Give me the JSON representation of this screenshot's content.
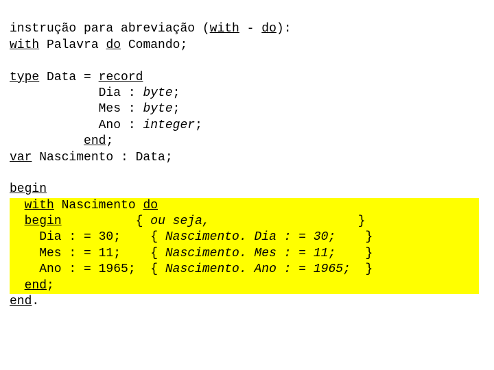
{
  "header": {
    "line1_a": "instrução para abreviação (",
    "line1_with": "with",
    "line1_mid": " - ",
    "line1_do": "do",
    "line1_end": "):",
    "line2_with": "with",
    "line2_mid": " Palavra ",
    "line2_do": "do",
    "line2_end": " Comando;"
  },
  "typedef": {
    "type_kw": "type",
    "type_rest": " Data = ",
    "record_kw": "record",
    "dia_label": "            Dia : ",
    "dia_type": "byte",
    "mes_label": "            Mes : ",
    "mes_type": "byte",
    "ano_label": "            Ano : ",
    "ano_type": "integer",
    "end_pad": "          ",
    "end_kw": "end",
    "end_semi": ";",
    "var_kw": "var",
    "var_rest": " Nascimento : Data;"
  },
  "body": {
    "begin_kw": "begin",
    "with_pad": "  ",
    "with_kw": "with",
    "with_mid": " Nascimento ",
    "do_kw": "do",
    "inner_begin_pad": "  ",
    "inner_begin_kw": "begin",
    "inner_begin_rest": "          ",
    "c1_open": "{ ",
    "c1_text": "ou seja,                   ",
    "c1_close": " }",
    "dia_line": "    Dia : = 30;    ",
    "c2_open": "{ ",
    "c2_text": "Nascimento. Dia : = 30;  ",
    "c2_close": "  }",
    "mes_line": "    Mes : = 11;    ",
    "c3_open": "{ ",
    "c3_text": "Nascimento. Mes : = 11;  ",
    "c3_close": "  }",
    "ano_line": "    Ano : = 1965;  ",
    "c4_open": "{ ",
    "c4_text": "Nascimento. Ano : = 1965;",
    "c4_close": "  }",
    "inner_end_pad": "  ",
    "inner_end_kw": "end",
    "inner_end_semi": ";",
    "outer_end_kw": "end",
    "outer_end_dot": "."
  }
}
